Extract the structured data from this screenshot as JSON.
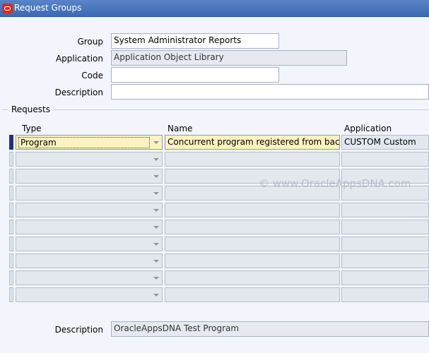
{
  "window": {
    "title": "Request Groups",
    "logo_icon": "oracle-logo-icon"
  },
  "header_form": {
    "group_label": "Group",
    "group_value": "System Administrator Reports",
    "application_label": "Application",
    "application_value": "Application Object Library",
    "code_label": "Code",
    "code_value": "",
    "description_label": "Description",
    "description_value": ""
  },
  "requests": {
    "section_label": "Requests",
    "columns": {
      "type": "Type",
      "name": "Name",
      "application": "Application"
    },
    "rows": [
      {
        "type": "Program",
        "name": "Concurrent program registered from backend",
        "application": "CUSTOM Custom"
      },
      {
        "type": "",
        "name": "",
        "application": ""
      },
      {
        "type": "",
        "name": "",
        "application": ""
      },
      {
        "type": "",
        "name": "",
        "application": ""
      },
      {
        "type": "",
        "name": "",
        "application": ""
      },
      {
        "type": "",
        "name": "",
        "application": ""
      },
      {
        "type": "",
        "name": "",
        "application": ""
      },
      {
        "type": "",
        "name": "",
        "application": ""
      },
      {
        "type": "",
        "name": "",
        "application": ""
      },
      {
        "type": "",
        "name": "",
        "application": ""
      }
    ]
  },
  "footer": {
    "description_label": "Description",
    "description_value": "OracleAppsDNA Test Program"
  },
  "watermark": "© www.OracleAppsDNA.com",
  "colors": {
    "titlebar": "#3c69b4",
    "current_field": "#fcf2c0",
    "row_indicator_active": "#1c2f8f"
  }
}
